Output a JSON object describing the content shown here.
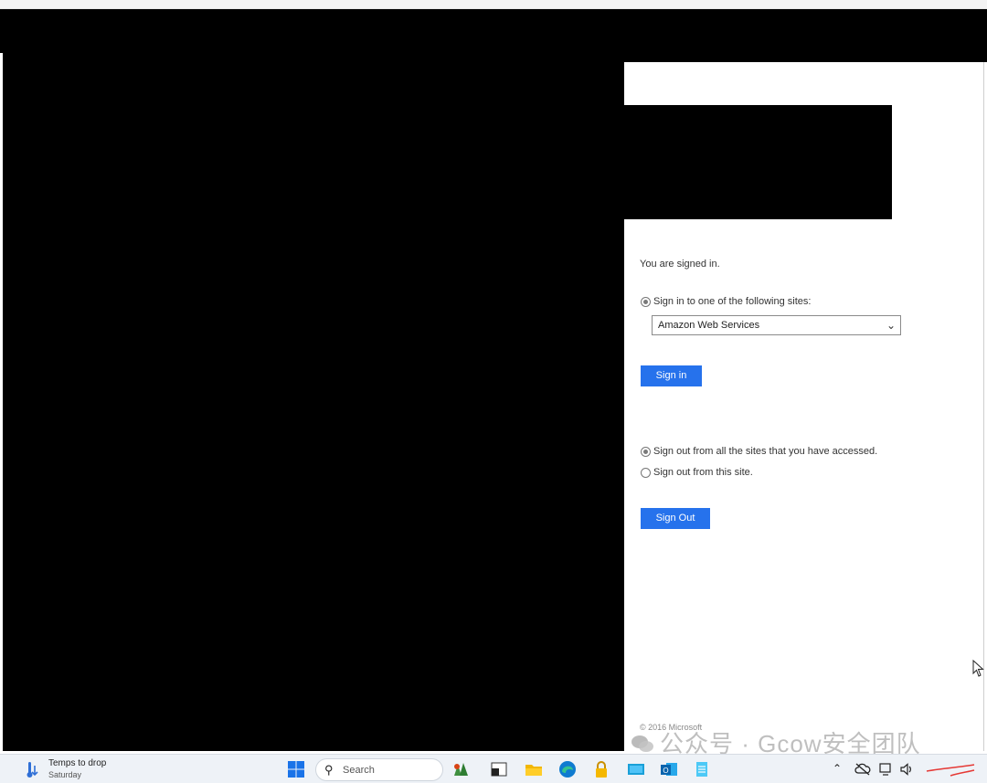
{
  "adfs": {
    "status_text": "You are signed in.",
    "signin_option_label": "Sign in to one of the following sites:",
    "site_select_value": "Amazon Web Services",
    "signin_button": "Sign in",
    "signout_all_label": "Sign out from all the sites that you have accessed.",
    "signout_this_label": "Sign out from this site.",
    "signout_button": "Sign Out",
    "copyright": "© 2016 Microsoft",
    "radios": {
      "signin_selected": true,
      "signout_all_selected": true,
      "signout_this_selected": false
    }
  },
  "watermark": {
    "text": "公众号 · Gcow安全团队"
  },
  "taskbar": {
    "weather_title": "Temps to drop",
    "weather_subtitle": "Saturday",
    "search_placeholder": "Search",
    "icons": [
      "weather-icon",
      "windows-start-icon",
      "search-icon",
      "widgets-icon",
      "terminal-icon",
      "file-explorer-icon",
      "edge-icon",
      "lock-app-icon",
      "screen-app-icon",
      "outlook-icon",
      "notepad-icon"
    ],
    "tray_icons": [
      "chevron-up-icon",
      "cloud-off-icon",
      "network-icon",
      "volume-icon"
    ]
  },
  "colors": {
    "accent_button": "#2672ec",
    "redaction": "#000000",
    "taskbar_bg": "#eef2f7"
  }
}
